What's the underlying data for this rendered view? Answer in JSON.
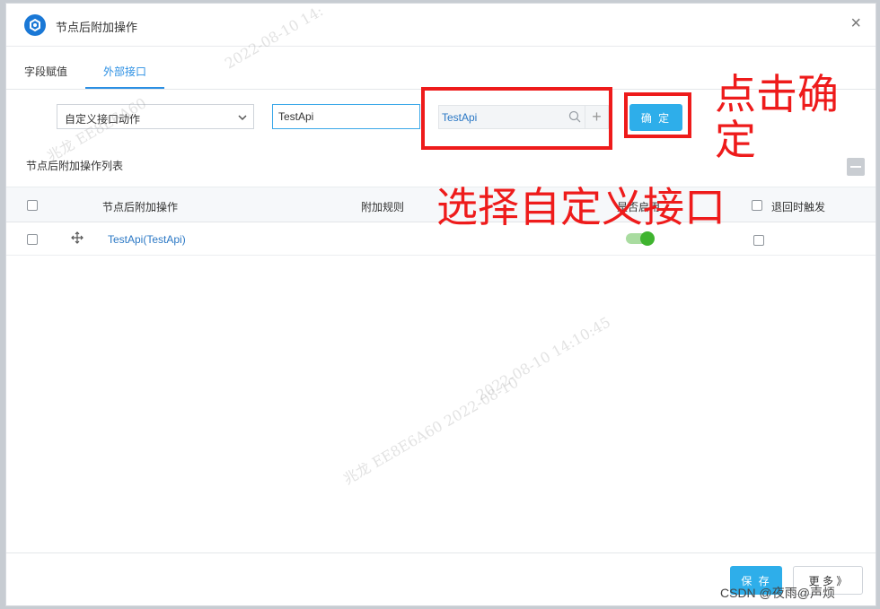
{
  "dialog": {
    "title": "节点后附加操作",
    "close_glyph": "×"
  },
  "tabs": [
    {
      "label": "字段赋值",
      "active": false
    },
    {
      "label": "外部接口",
      "active": true
    }
  ],
  "form": {
    "action_select_value": "自定义接口动作",
    "name_input_value": "TestApi",
    "interface_search_value": "TestApi",
    "add_glyph": "+",
    "confirm_label": "确 定"
  },
  "list": {
    "title": "节点后附加操作列表",
    "columns": [
      "节点后附加操作",
      "附加规则",
      "是否启用",
      "退回时触发"
    ],
    "rows": [
      {
        "operation": "TestApi(TestApi)",
        "rule": "",
        "enabled": true,
        "trigger_on_return": false
      }
    ]
  },
  "footer": {
    "save_label": "保 存",
    "more_label": "更 多 》"
  },
  "watermarks": [
    "2022-08-10  14:",
    "兆龙  EE8E6A60",
    "2022-08-10  14:10:45",
    "兆龙  EE8E6A60  2022-08-10"
  ],
  "annotations": {
    "click_confirm": "点击确定",
    "select_custom": "选择自定义接口"
  },
  "credit": "CSDN @夜雨@声烦",
  "colors": {
    "accent": "#2eaeea",
    "link": "#2b78c5",
    "annotation_red": "#ee1b1b",
    "toggle_on": "#3fb42f"
  },
  "icons": [
    "logo-icon",
    "close-icon",
    "chevron-down-icon",
    "search-icon",
    "plus-icon",
    "drag-handle-icon",
    "minus-icon"
  ]
}
